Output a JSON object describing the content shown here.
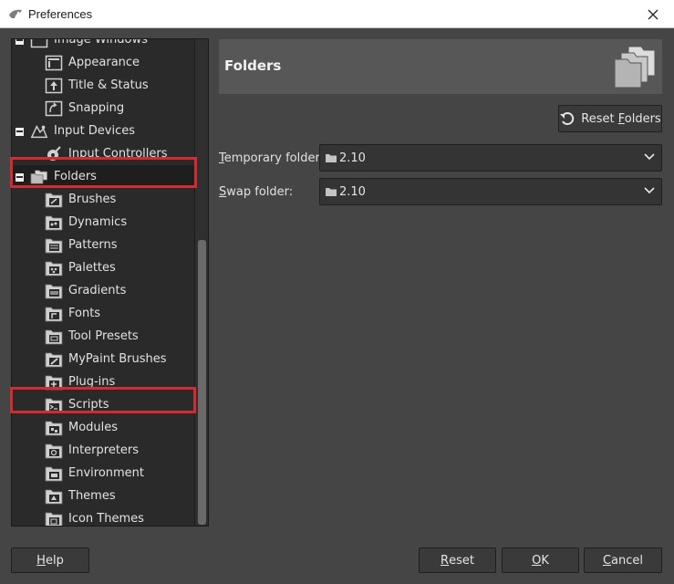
{
  "window": {
    "title": "Preferences",
    "close_icon": "close-icon"
  },
  "tree": {
    "items": [
      {
        "label": "Image Windows",
        "level": 1,
        "icon": "image-windows-icon"
      },
      {
        "label": "Appearance",
        "level": 2,
        "icon": "appearance-icon"
      },
      {
        "label": "Title & Status",
        "level": 2,
        "icon": "title-status-icon"
      },
      {
        "label": "Snapping",
        "level": 2,
        "icon": "snapping-icon"
      },
      {
        "label": "Input Devices",
        "level": 1,
        "icon": "input-devices-icon"
      },
      {
        "label": "Input Controllers",
        "level": 2,
        "icon": "input-controllers-icon"
      },
      {
        "label": "Folders",
        "level": 1,
        "icon": "folders-icon",
        "selected": true
      },
      {
        "label": "Brushes",
        "level": 2,
        "icon": "brushes-folder-icon"
      },
      {
        "label": "Dynamics",
        "level": 2,
        "icon": "dynamics-folder-icon"
      },
      {
        "label": "Patterns",
        "level": 2,
        "icon": "patterns-folder-icon"
      },
      {
        "label": "Palettes",
        "level": 2,
        "icon": "palettes-folder-icon"
      },
      {
        "label": "Gradients",
        "level": 2,
        "icon": "gradients-folder-icon"
      },
      {
        "label": "Fonts",
        "level": 2,
        "icon": "fonts-folder-icon"
      },
      {
        "label": "Tool Presets",
        "level": 2,
        "icon": "tool-presets-folder-icon"
      },
      {
        "label": "MyPaint Brushes",
        "level": 2,
        "icon": "mypaint-brushes-folder-icon"
      },
      {
        "label": "Plug-ins",
        "level": 2,
        "icon": "plug-ins-folder-icon"
      },
      {
        "label": "Scripts",
        "level": 2,
        "icon": "scripts-folder-icon"
      },
      {
        "label": "Modules",
        "level": 2,
        "icon": "modules-folder-icon"
      },
      {
        "label": "Interpreters",
        "level": 2,
        "icon": "interpreters-folder-icon"
      },
      {
        "label": "Environment",
        "level": 2,
        "icon": "environment-folder-icon"
      },
      {
        "label": "Themes",
        "level": 2,
        "icon": "themes-folder-icon"
      },
      {
        "label": "Icon Themes",
        "level": 2,
        "icon": "icon-themes-folder-icon"
      }
    ]
  },
  "panel": {
    "title": "Folders",
    "reset_folders_prefix": "Reset ",
    "reset_folders_mnemonic": "F",
    "reset_folders_rest": "olders",
    "fields": [
      {
        "mnemonic": "T",
        "label_rest": "emporary folder:",
        "value": "2.10"
      },
      {
        "mnemonic": "S",
        "label_rest": "wap folder:",
        "value": "2.10"
      }
    ]
  },
  "buttons": {
    "help_mnemonic": "H",
    "help_rest": "elp",
    "reset_mnemonic": "R",
    "reset_rest": "eset",
    "ok_mnemonic": "O",
    "ok_rest": "K",
    "cancel_mnemonic": "C",
    "cancel_rest": "ancel"
  },
  "colors": {
    "highlight": "#d42a32",
    "background": "#454545",
    "tree_background": "#2a2a2a"
  }
}
